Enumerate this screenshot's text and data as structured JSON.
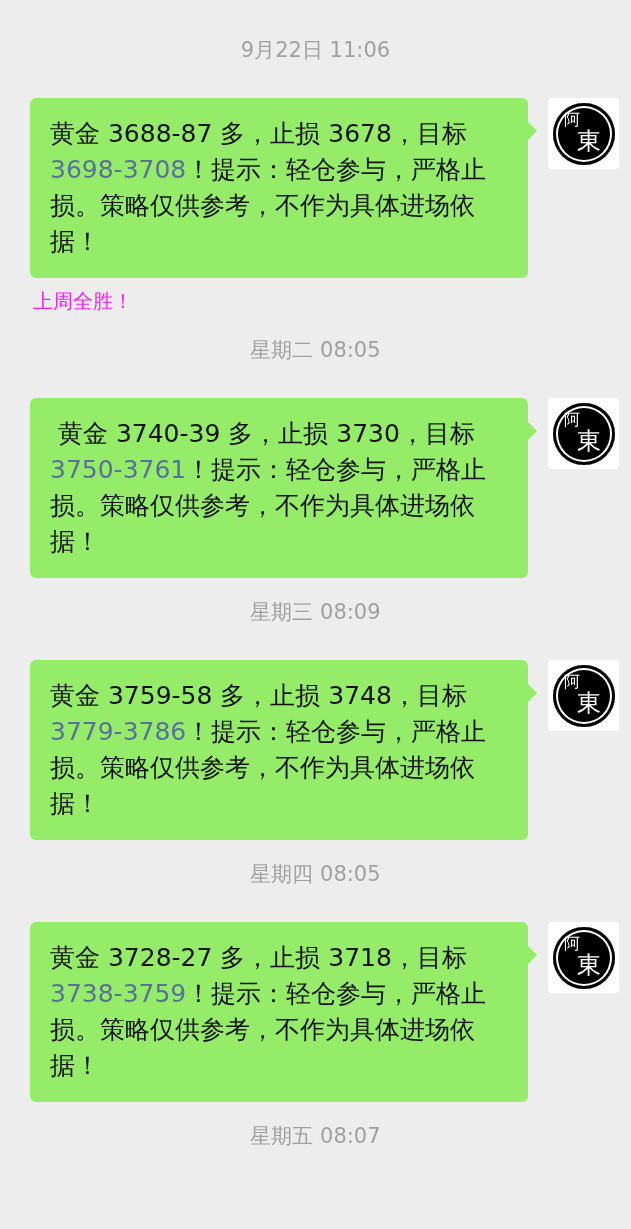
{
  "items": [
    {
      "kind": "time",
      "text": "9月22日 11:06"
    },
    {
      "kind": "message",
      "text_before": "黄金 3688-87 多，止损 3678，目标",
      "link": "3698-3708",
      "text_after": "！提示：轻仓参与，严格止损。策略仅供参考，不作为具体进场依据！",
      "avatar": [
        "阿",
        "東"
      ]
    },
    {
      "kind": "note",
      "text": "上周全胜！"
    },
    {
      "kind": "time",
      "text": "星期二 08:05"
    },
    {
      "kind": "message",
      "text_before": " 黄金 3740-39 多，止损 3730，目标",
      "link": "3750-3761",
      "text_after": "！提示：轻仓参与，严格止损。策略仅供参考，不作为具体进场依据！",
      "avatar": [
        "阿",
        "東"
      ]
    },
    {
      "kind": "time",
      "text": "星期三 08:09"
    },
    {
      "kind": "message",
      "text_before": "黄金 3759-58 多，止损 3748，目标",
      "link": "3779-3786",
      "text_after": "！提示：轻仓参与，严格止损。策略仅供参考，不作为具体进场依据！",
      "avatar": [
        "阿",
        "東"
      ]
    },
    {
      "kind": "time",
      "text": "星期四 08:05"
    },
    {
      "kind": "message",
      "text_before": "黄金 3728-27 多，止损 3718，目标",
      "link": "3738-3759",
      "text_after": "！提示：轻仓参与，严格止损。策略仅供参考，不作为具体进场依据！",
      "avatar": [
        "阿",
        "東"
      ]
    },
    {
      "kind": "time",
      "text": "星期五 08:07"
    }
  ]
}
